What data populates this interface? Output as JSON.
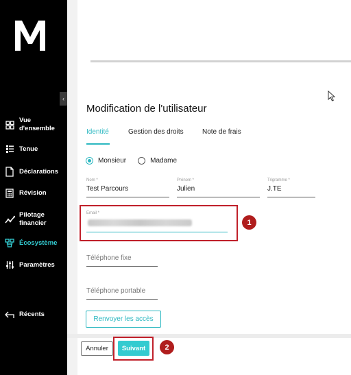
{
  "sidebar": {
    "items": [
      {
        "label": "Vue d'ensemble",
        "line1": "Vue",
        "line2": "d'ensemble",
        "icon": "dashboard-icon"
      },
      {
        "label": "Tenue",
        "icon": "list-icon"
      },
      {
        "label": "Déclarations",
        "icon": "document-icon"
      },
      {
        "label": "Révision",
        "icon": "calculator-icon"
      },
      {
        "label": "Pilotage financier",
        "line1": "Pilotage",
        "line2": "financier",
        "icon": "trend-icon"
      },
      {
        "label": "Écosystème",
        "icon": "ecosystem-icon"
      },
      {
        "label": "Paramètres",
        "icon": "sliders-icon"
      },
      {
        "label": "Récents",
        "icon": "back-arrow-icon"
      }
    ],
    "collapse_glyph": "‹"
  },
  "page": {
    "title": "Modification de l'utilisateur"
  },
  "tabs": [
    "Identité",
    "Gestion des droits",
    "Note de frais"
  ],
  "civility": {
    "options": [
      "Monsieur",
      "Madame"
    ],
    "selected": "Monsieur"
  },
  "form": {
    "nom": {
      "label": "Nom *",
      "value": "Test Parcours"
    },
    "prenom": {
      "label": "Prénom *",
      "value": "Julien"
    },
    "trigramme": {
      "label": "Trigramme *",
      "value": "J.TE"
    },
    "email": {
      "label": "Email *"
    },
    "telephone_fixe": {
      "placeholder": "Téléphone fixe"
    },
    "telephone_portable": {
      "placeholder": "Téléphone portable"
    }
  },
  "buttons": {
    "resend": "Renvoyer les accès",
    "cancel": "Annuler",
    "next": "Suivant"
  },
  "annotations": [
    "1",
    "2"
  ],
  "colors": {
    "accent": "#2ab7c0",
    "highlight": "#c0202a",
    "sidebar_bg": "#000000"
  }
}
